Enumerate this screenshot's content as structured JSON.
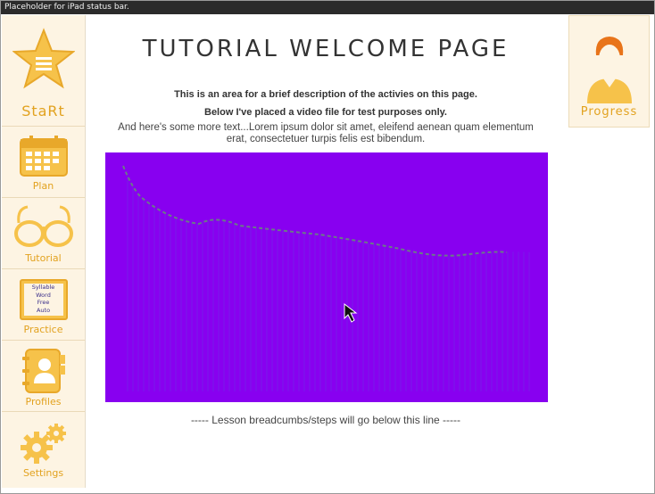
{
  "status_bar": {
    "text": "Placeholder for iPad status bar."
  },
  "sidebar": {
    "items": [
      {
        "label": "StaRt",
        "icon": "star-icon"
      },
      {
        "label": "Plan",
        "icon": "calendar-icon"
      },
      {
        "label": "Tutorial",
        "icon": "glasses-icon"
      },
      {
        "label": "Practice",
        "icon": "practice-board-icon",
        "icon_lines": [
          "Syllable",
          "Word",
          "Free",
          "Auto"
        ]
      },
      {
        "label": "Profiles",
        "icon": "address-book-icon"
      },
      {
        "label": "Settings",
        "icon": "gears-icon"
      }
    ]
  },
  "progress": {
    "label": "Progress",
    "icon": "user-avatar-icon"
  },
  "main": {
    "title": "TUTORIAL WELCOME PAGE",
    "line1": "This is an area for a brief description of the activies on this page.",
    "line2": "Below I've placed a video file for test purposes only.",
    "line3": "And here's some more text...Lorem ipsum dolor sit amet, eleifend aenean quam elementum erat, consectetuer turpis felis est bibendum.",
    "breadcrumb_text": "----- Lesson breadcumbs/steps will go below this line -----"
  },
  "colors": {
    "accent": "#e2a21f",
    "sidebar_bg": "#fdf4e3",
    "video_bg": "#8800f0"
  }
}
